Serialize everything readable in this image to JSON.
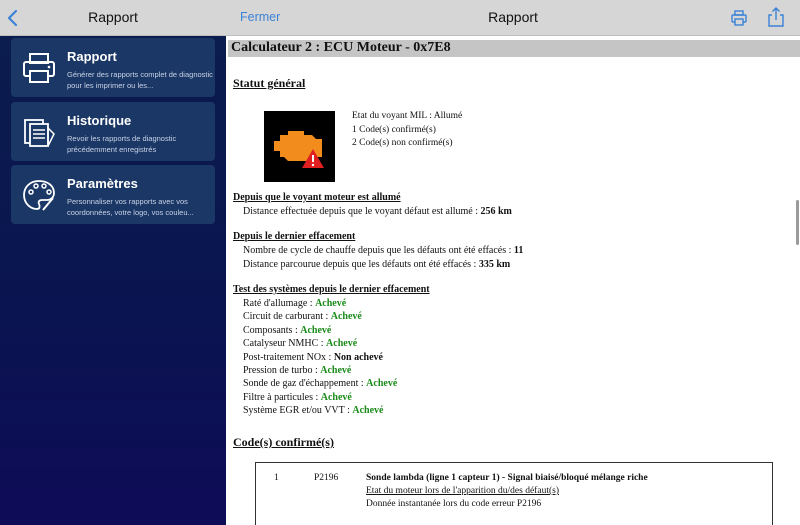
{
  "sidebar": {
    "title": "Rapport",
    "items": [
      {
        "title": "Rapport",
        "description": "Générer des rapports complet de diagnostic pour les imprimer ou les...",
        "icon": "printer-icon"
      },
      {
        "title": "Historique",
        "description": "Revoir les rapports de diagnostic précédemment enregistrés",
        "icon": "history-documents-icon"
      },
      {
        "title": "Paramètres",
        "description": "Personnaliser vos rapports avec vos coordonnées, votre logo, vos couleu...",
        "icon": "palette-icon"
      }
    ]
  },
  "header": {
    "close_label": "Fermer",
    "title": "Rapport"
  },
  "report": {
    "ecu_title": "Calculateur 2 : ECU Moteur - 0x7E8",
    "general_status": "Statut général",
    "mil_state": "Etat du voyant MIL : Allumé",
    "confirmed_count": "1 Code(s) confirmé(s)",
    "unconfirmed_count": "2 Code(s) non confirmé(s)",
    "since_mil_heading": "Depuis que le voyant moteur est allumé",
    "since_mil_distance_label": "Distance effectuée depuis que le voyant défaut est allumé : ",
    "since_mil_distance_value": "256 km",
    "since_clear_heading": "Depuis le dernier effacement",
    "warmup_label": "Nombre de cycle de chauffe depuis que les défauts ont été effacés : ",
    "warmup_value": "11",
    "distance_clear_label": "Distance parcourue depuis que les défauts ont été effacés : ",
    "distance_clear_value": "335 km",
    "tests_heading": "Test des systèmes depuis le dernier effacement",
    "tests": [
      {
        "label": "Raté d'allumage : ",
        "status": "Achevé",
        "ok": true
      },
      {
        "label": "Circuit de carburant : ",
        "status": "Achevé",
        "ok": true
      },
      {
        "label": "Composants : ",
        "status": "Achevé",
        "ok": true
      },
      {
        "label": "Catalyseur NMHC : ",
        "status": "Achevé",
        "ok": true
      },
      {
        "label": "Post-traitement NOx : ",
        "status": "Non achevé",
        "ok": false
      },
      {
        "label": "Pression de turbo : ",
        "status": "Achevé",
        "ok": true
      },
      {
        "label": "Sonde de gaz d'échappement : ",
        "status": "Achevé",
        "ok": true
      },
      {
        "label": "Filtre à particules : ",
        "status": "Achevé",
        "ok": true
      },
      {
        "label": "Système EGR et/ou VVT : ",
        "status": "Achevé",
        "ok": true
      }
    ],
    "confirmed_heading": "Code(s) confirmé(s)",
    "codes": [
      {
        "index": "1",
        "code": "P2196",
        "description": "Sonde lambda (ligne 1 capteur 1) - Signal biaisé/bloqué mélange riche",
        "state_link": "Etat du moteur lors de l'apparition du/des défaut(s)",
        "snapshot": "Donnée instantanée lors du code erreur P2196"
      }
    ]
  },
  "colors": {
    "header_bg": "#d6d6d6",
    "accent": "#3b82d6",
    "sidebar_bg": "#0a1550",
    "card_bg": "#1b3766",
    "ok_green": "#1a8a1a",
    "engine_icon": "#f28c1c",
    "warning_red": "#e02020"
  }
}
